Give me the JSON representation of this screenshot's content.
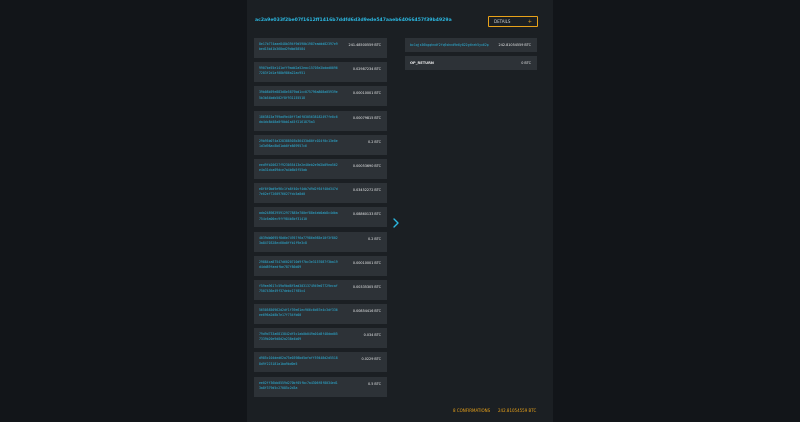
{
  "transaction": {
    "txid": "ac2a9e033f2be07f1612ff1416b7ddfd6d3d9ede547aaeb64066457f39b4929a",
    "details_label": "DETAILS",
    "details_icon": "plus-icon",
    "confirmations": "8 CONFIRMATIONS",
    "total": "242.81054559 BTC"
  },
  "inputs": [
    {
      "address": "8e17b774aae848b394f9d590b1987eaddd82397e9bed15b41b368ad29dbd58584",
      "amount": "241.48500559 BTC"
    },
    {
      "address": "9907be55e141aff9add2a52eac15705e2bdad00967283f2d1af08b986a22ac951",
      "amount": "0.02987234 BTC"
    },
    {
      "address": "39b08b59e883d8e5879bd1cc075796a808a05939e5b3b54bdb502f8f931155518",
      "amount": "0.00010001 BTC"
    },
    {
      "address": "1863815a799ad9e40ff7a6f0305638182497fe0c6da4dc8d48a0f0bb1a45f2161875a3",
      "amount": "0.00079815 BTC"
    },
    {
      "address": "29b95b074a328388503b36433b80fc024f0c13e0e1d3d98ac8b61ab0fe869957c6",
      "amount": "0.2 BTC"
    },
    {
      "address": "eed9fb20627f923055413e2e40eb2e9d2b09ea562e4a31dca09dce7a4b6b5f55ab",
      "amount": "0.00053690 BTC"
    },
    {
      "address": "e8f6f0bd9e96c1fa8f40cf4db7d9d2f64f40d347d7e02ef7260976627fdc5a8d0",
      "amount": "0.03452272 BTC"
    },
    {
      "address": "ada24898295912977885e700ef88e4eb0ab8c4dba754c6a00ec9ff984b5bf31410",
      "amount": "0.08860133 BTC"
    },
    {
      "address": "4039db0695f8d6e74957f6a77986a985e10f3f8023a8470328ec60a0ffb1f9e3c8",
      "amount": "0.2 BTC"
    },
    {
      "address": "29884ca87547d6020710d9f7bc3e3157087f3ba19d4dd89faedfbe787f86d09",
      "amount": "0.00010001 BTC"
    },
    {
      "address": "f59ea9617c59a9bd8f5ad3031374949e07729ecaf7507436e49f37debc17f85c4",
      "amount": "0.00335305 BTC"
    },
    {
      "address": "56505850962d2df1f39e61ec966c6d67e4c3df336ee696a2d8b7e17f754fb00",
      "amount": "0.00854416 BTC"
    },
    {
      "address": "79d9d733a6813842df5c1ab0b049a01d8f48dad057339b20e9d8d2a238e4b09",
      "amount": "0.034 BTC"
    },
    {
      "address": "d985c104ded62a75e0398bd5afaff59448d2d55188d9f223181a1ba9bd0e5",
      "amount": "0.0229 BTC"
    },
    {
      "address": "ee02ff36bb0559d270bf05fbc7a4306f8f8034ed13a8f379d5c27085c2d3a",
      "amount": "0.5 BTC"
    }
  ],
  "outputs": [
    {
      "address": "bc1qjs56kgqhndf2fq9xhnd9e6y822gtheh5yx62p",
      "amount": "242.81054559 BTC"
    },
    {
      "label": "OP_RETURN",
      "amount": "0 BTC"
    }
  ],
  "colors": {
    "accent": "#e8a21a",
    "link": "#2bb7e0",
    "row_bg": "#2d3237",
    "panel_bg": "#1b1f23"
  },
  "icons": {
    "transfer_arrow": "chevron-right-icon"
  }
}
